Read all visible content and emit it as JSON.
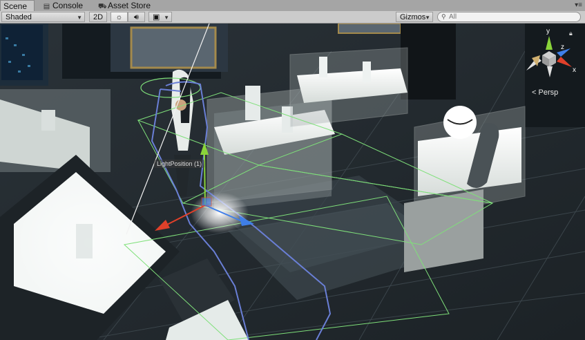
{
  "tabs": [
    {
      "label": "Scene",
      "icon": "scene-icon",
      "active": true
    },
    {
      "label": "Console",
      "icon": "console-icon",
      "active": false
    },
    {
      "label": "Asset Store",
      "icon": "asset-store-icon",
      "active": false
    }
  ],
  "toolbar": {
    "shading_mode": "Shaded",
    "mode_2d": "2D",
    "gizmos_label": "Gizmos",
    "search_placeholder": "All"
  },
  "viewport": {
    "selected_object_label": "LightPosition (1)",
    "projection_label": "Persp",
    "axis_labels": {
      "x": "x",
      "y": "y",
      "z": "z"
    }
  },
  "colors": {
    "x_axis": "#e0402a",
    "y_axis": "#8ad43a",
    "z_axis": "#3f7fe8",
    "bounds_outline": "#7fe07a",
    "path_outline": "#6a7fd6"
  }
}
